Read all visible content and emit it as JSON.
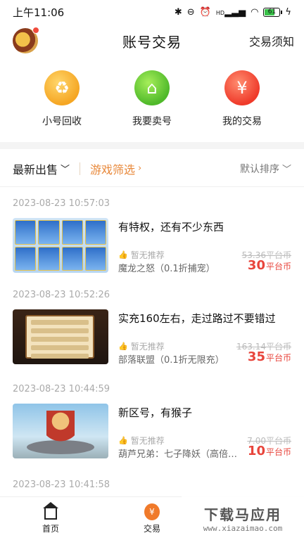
{
  "status_bar": {
    "time": "上午11:06",
    "network": "HD",
    "battery": "61",
    "battery_level": 0.61
  },
  "header": {
    "title": "账号交易",
    "notice": "交易须知"
  },
  "quick_actions": [
    {
      "label": "小号回收",
      "icon": "recycle-icon",
      "icon_glyph": "♻"
    },
    {
      "label": "我要卖号",
      "icon": "shop-icon",
      "icon_glyph": "⌂"
    },
    {
      "label": "我的交易",
      "icon": "money-bag-icon",
      "icon_glyph": "¥"
    }
  ],
  "filter": {
    "latest": "最新出售",
    "game_filter": "游戏筛选",
    "sort": "默认排序"
  },
  "listings": [
    {
      "date": "2023-08-23 10:57:03",
      "title": "有特权，还有不少东西",
      "recommend": "暂无推荐",
      "game": "魔龙之怒（0.1折捕宠）",
      "original_price": "53.36平台币",
      "price": "30",
      "unit": "平台币"
    },
    {
      "date": "2023-08-23 10:52:26",
      "title": "实充160左右，走过路过不要错过",
      "recommend": "暂无推荐",
      "game": "部落联盟（0.1折无限充）",
      "original_price": "163.14平台币",
      "price": "35",
      "unit": "平台币"
    },
    {
      "date": "2023-08-23 10:44:59",
      "title": "新区号，有猴子",
      "recommend": "暂无推荐",
      "game": "葫芦兄弟：七子降妖（高倍…",
      "original_price": "7.00平台币",
      "price": "10",
      "unit": "平台币"
    },
    {
      "date": "2023-08-23 10:41:58"
    }
  ],
  "tabbar": {
    "home": "首页",
    "trade": "交易"
  },
  "watermark": {
    "line1": "下载马应用",
    "line2": "www.xiazaimao.com"
  },
  "colors": {
    "accent": "#e8883a",
    "price": "#e8453c"
  }
}
